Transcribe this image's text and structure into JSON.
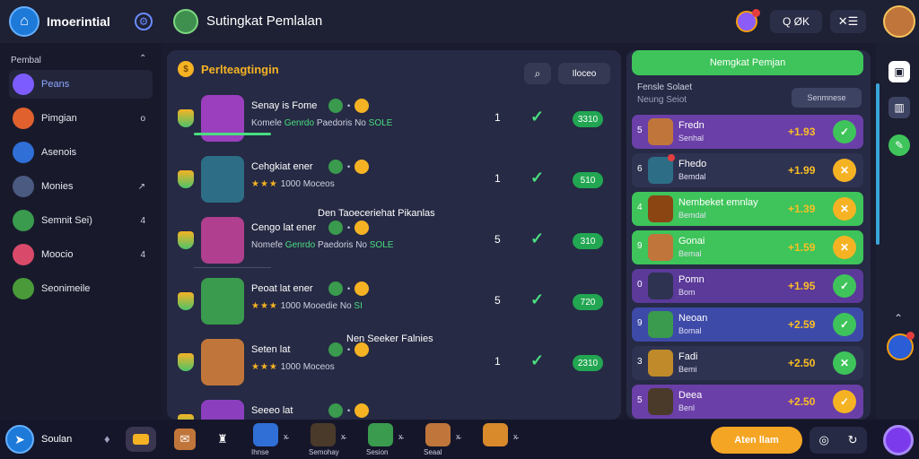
{
  "app": {
    "logo_label": "Imoerintial",
    "title": "Sutingkat Pemlalan"
  },
  "top": {
    "search_label": "Q  ØK",
    "menu_icon": "✕☰"
  },
  "sidebar": {
    "heading": "Pembal",
    "items": [
      {
        "label": "Peans",
        "count": "",
        "color": "#7c5cff",
        "active": true
      },
      {
        "label": "Pimgian",
        "count": "o",
        "color": "#e0612e",
        "active": false
      },
      {
        "label": "Asenois",
        "count": "",
        "color": "#2f6fd6",
        "active": false
      },
      {
        "label": "Monies",
        "count": "↗",
        "color": "#4b5a80",
        "active": false
      },
      {
        "label": "Semnit Sei)",
        "count": "4",
        "color": "#3a9a4e",
        "active": false
      },
      {
        "label": "Moocio",
        "count": "4",
        "color": "#d94a6a",
        "active": false
      },
      {
        "label": "Seonimeile",
        "count": "",
        "color": "#4a9a3a",
        "active": false
      }
    ]
  },
  "main": {
    "title": "Perlteagtingin",
    "button_label": "Iloceo",
    "rows": [
      {
        "name": "Senay is Fome",
        "sub_a": "Komele",
        "sub_hl": "Genrdo",
        "sub_b": "Paedoris",
        "sub_c": "No",
        "pill_tag": "SOLE",
        "num": "1",
        "pill": "3310",
        "stars": "",
        "avatar": "#9b3fbf"
      },
      {
        "name": "Cehgkiat ener",
        "sub_a": "",
        "sub_hl": "",
        "sub_b": "1000  Moceos",
        "sub_c": "",
        "pill_tag": "",
        "num": "1",
        "pill": "510",
        "stars": "★★★",
        "avatar": "#2d6e86"
      },
      {
        "name": "Cengo lat ener",
        "sub_a": "Nomefe",
        "sub_hl": "Genrdo",
        "sub_b": "Paedoris",
        "sub_c": "No",
        "pill_tag": "SOLE",
        "num": "5",
        "pill": "310",
        "stars": "",
        "avatar": "#b03f8f"
      },
      {
        "name": "Peoat lat ener",
        "sub_a": "",
        "sub_hl": "",
        "sub_b": "1000  Mooedie No",
        "sub_c": "",
        "pill_tag": "SI",
        "num": "5",
        "pill": "720",
        "stars": "★★★",
        "avatar": "#3a9a4e"
      },
      {
        "name": "Seten lat",
        "sub_a": "",
        "sub_hl": "",
        "sub_b": "1000  Moceos",
        "sub_c": "",
        "pill_tag": "",
        "num": "1",
        "pill": "2310",
        "stars": "★★★",
        "avatar": "#c0763b"
      },
      {
        "name": "Seeeo lat",
        "sub_a": "",
        "sub_hl": "",
        "sub_b": "",
        "sub_c": "",
        "pill_tag": "",
        "num": "",
        "pill": "",
        "stars": "",
        "avatar": "#8b3fbf"
      }
    ],
    "overlay_1": "Den Taoeceriehat Pikanlas",
    "overlay_2": "Nen Seeker Falnies"
  },
  "leaderboard": {
    "header": "Nemgkat Pemjan",
    "sub_1": "Fensle Solaet",
    "sub_2": "Neung Seiot",
    "button": "Senmnese",
    "rows": [
      {
        "rank": "5",
        "name": "Fredn",
        "sub": "Senhal",
        "score": "+1.93",
        "bg": "#6b3fa8",
        "act_bg": "#3ec45a",
        "act": "✓",
        "ava": "#c0763b",
        "badge": false
      },
      {
        "rank": "6",
        "name": "Fhedo",
        "sub": "Bemdal",
        "score": "+1.99",
        "bg": "#2f3352",
        "act_bg": "#f5b324",
        "act": "✕",
        "ava": "#2d6e86",
        "badge": true
      },
      {
        "rank": "4",
        "name": "Nembeket emnlay",
        "sub": "Bemdal",
        "score": "+1.39",
        "bg": "#3ec45a",
        "act_bg": "#f5b324",
        "act": "✕",
        "ava": "#8b4513",
        "badge": false
      },
      {
        "rank": "9",
        "name": "Gonai",
        "sub": "Bemal",
        "score": "+1.59",
        "bg": "#3ec45a",
        "act_bg": "#f5b324",
        "act": "✕",
        "ava": "#c0763b",
        "badge": false
      },
      {
        "rank": "0",
        "name": "Pomn",
        "sub": "Bom",
        "score": "+1.95",
        "bg": "#5b3a9a",
        "act_bg": "#3ec45a",
        "act": "✓",
        "ava": "#2f3352",
        "badge": false
      },
      {
        "rank": "9",
        "name": "Neoan",
        "sub": "Bomal",
        "score": "+2.59",
        "bg": "#3e4aa8",
        "act_bg": "#3ec45a",
        "act": "✓",
        "ava": "#3a9a4e",
        "badge": false
      },
      {
        "rank": "3",
        "name": "Fadi",
        "sub": "Bemi",
        "score": "+2.50",
        "bg": "#2f3352",
        "act_bg": "#3ec45a",
        "act": "✕",
        "ava": "#c08a2b",
        "badge": false
      },
      {
        "rank": "5",
        "name": "Deea",
        "sub": "Benl",
        "score": "+2.50",
        "bg": "#6b3fa8",
        "act_bg": "#f5b324",
        "act": "✓",
        "ava": "#4a3a2a",
        "badge": false
      }
    ]
  },
  "bottom": {
    "label": "Soulan",
    "chars": [
      {
        "label": "Ihnse",
        "color": "#2f6fd6"
      },
      {
        "label": "Semohay",
        "color": "#4a3a2a"
      },
      {
        "label": "Sesion",
        "color": "#3a9a4e"
      },
      {
        "label": "Seaal",
        "color": "#c0763b"
      },
      {
        "label": "",
        "color": "#d98a2b"
      }
    ],
    "cta": "Aten llam"
  }
}
